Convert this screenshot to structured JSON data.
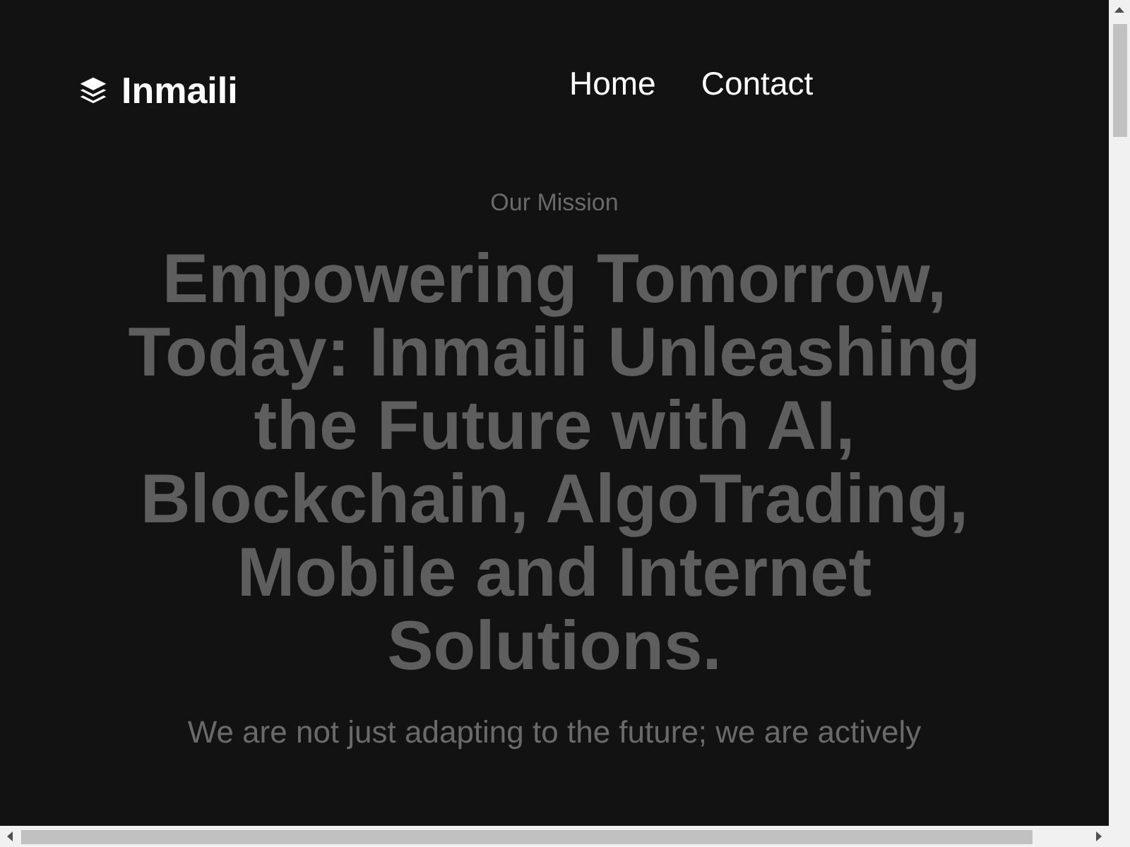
{
  "header": {
    "brand": "Inmaili",
    "nav": [
      {
        "label": "Home"
      },
      {
        "label": "Contact"
      }
    ]
  },
  "hero": {
    "eyebrow": "Our Mission",
    "headline": "Empowering Tomorrow, Today: Inmaili Unleashing the Future with AI, Blockchain, AlgoTrading, Mobile and Internet Solutions.",
    "text": "We are not just adapting to the future; we are actively"
  }
}
